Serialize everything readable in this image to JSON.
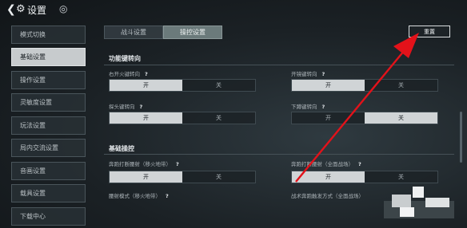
{
  "header": {
    "title": "设置",
    "back_icon": "chevron-left-icon",
    "gear_icon": "gear-icon",
    "gamepad_icon": "gamepad-icon"
  },
  "sidebar": {
    "items": [
      {
        "label": "模式切换",
        "active": false
      },
      {
        "label": "基础设置",
        "active": true
      },
      {
        "label": "操作设置",
        "active": false
      },
      {
        "label": "灵敏度设置",
        "active": false
      },
      {
        "label": "玩法设置",
        "active": false
      },
      {
        "label": "局内交流设置",
        "active": false
      },
      {
        "label": "音画设置",
        "active": false
      },
      {
        "label": "载具设置",
        "active": false
      },
      {
        "label": "下载中心",
        "active": false
      }
    ]
  },
  "tabs": [
    {
      "label": "战斗设置",
      "active": false
    },
    {
      "label": "操控设置",
      "active": true
    }
  ],
  "reset_label": "重置",
  "sections": {
    "function_keys": {
      "title": "功能键转向",
      "settings": [
        {
          "label": "右开火键转向",
          "on": "开",
          "off": "关",
          "selected": "on"
        },
        {
          "label": "开镜键转向",
          "on": "开",
          "off": "关",
          "selected": "on"
        },
        {
          "label": "探头键转向",
          "on": "开",
          "off": "关",
          "selected": "on"
        },
        {
          "label": "下蹲键转向",
          "on": "开",
          "off": "关",
          "selected": "off"
        }
      ]
    },
    "basic_controls": {
      "title": "基础操控",
      "settings": [
        {
          "label": "奔跑打断腰射（移火地带）",
          "on": "开",
          "off": "关",
          "selected": "on"
        },
        {
          "label": "奔跑打断腰射（全面战场）",
          "on": "开",
          "off": "关",
          "selected": "on"
        }
      ],
      "partial_labels": [
        "腰射模式（移火地带）",
        "战术奔跑触发方式（全面战场）"
      ]
    }
  },
  "colors": {
    "accent_arrow": "#e3121a",
    "selected_option": "#d0d4d6",
    "active_sidebar": "#c7cbcd"
  }
}
